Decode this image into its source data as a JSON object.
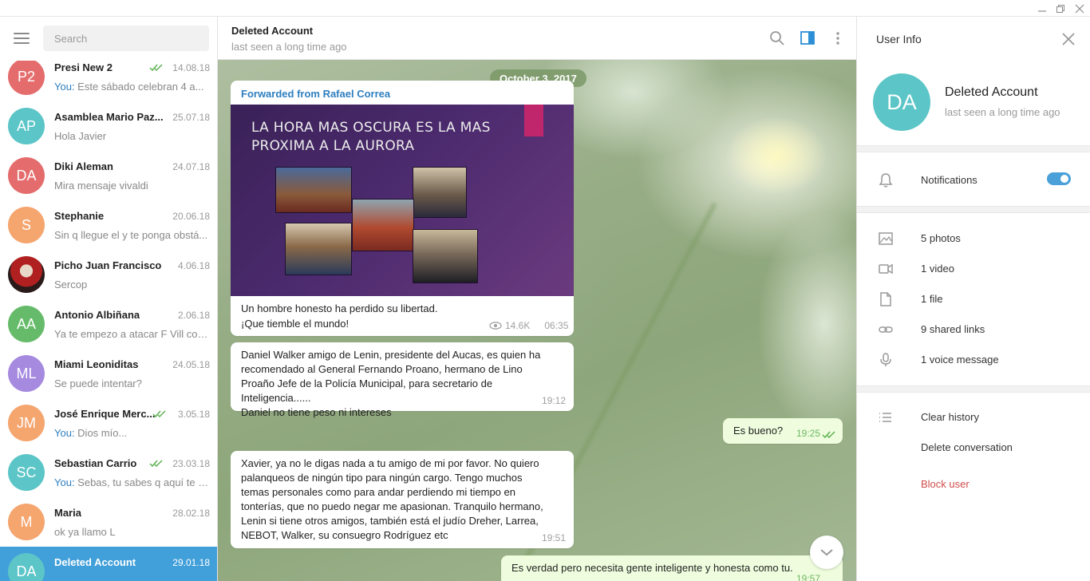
{
  "window": {
    "controls": [
      "minimize",
      "maximize",
      "close"
    ]
  },
  "sidebar": {
    "search_placeholder": "Search",
    "chats": [
      {
        "initials": "P2",
        "name": "Presi New 2",
        "date": "14.08.18",
        "you": "You:",
        "preview": "Este sábado celebran 4 a...",
        "color": "#e46c6c",
        "read": true
      },
      {
        "initials": "AP",
        "name": "Asamblea Mario Paz...",
        "date": "25.07.18",
        "you": "",
        "preview": "Hola Javier",
        "color": "#5bc5c7",
        "read": false
      },
      {
        "initials": "DA",
        "name": "Diki Aleman",
        "date": "24.07.18",
        "you": "",
        "preview": "Mira mensaje vivaldi",
        "color": "#e46c6c",
        "read": false
      },
      {
        "initials": "S",
        "name": "Stephanie",
        "date": "20.06.18",
        "you": "",
        "preview": "Sin q llegue el y te ponga obstá...",
        "color": "#f5a56e",
        "read": false
      },
      {
        "initials": "",
        "name": "Picho Juan Francisco",
        "date": "4.06.18",
        "you": "",
        "preview": "Sercop",
        "color": "#7a1a1a",
        "read": false
      },
      {
        "initials": "AA",
        "name": "Antonio Albiñana",
        "date": "2.06.18",
        "you": "",
        "preview": "Ya te empezo a atacar F Vill con...",
        "color": "#66bb6a",
        "read": false
      },
      {
        "initials": "ML",
        "name": "Miami Leoniditas",
        "date": "24.05.18",
        "you": "",
        "preview": "Se puede intentar?",
        "color": "#a58ae0",
        "read": false
      },
      {
        "initials": "JM",
        "name": "José Enrique Merc...",
        "date": "3.05.18",
        "you": "You:",
        "preview": "Dios mío...",
        "color": "#f5a56e",
        "read": true
      },
      {
        "initials": "SC",
        "name": "Sebastian Carrio",
        "date": "23.03.18",
        "you": "You:",
        "preview": "Sebas, tu sabes q aquí te q...",
        "color": "#5bc5c7",
        "read": true
      },
      {
        "initials": "M",
        "name": "Maria",
        "date": "28.02.18",
        "you": "",
        "preview": "ok ya llamo L",
        "color": "#f5a56e",
        "read": false
      },
      {
        "initials": "DA",
        "name": "Deleted Account",
        "date": "29.01.18",
        "you": "",
        "preview": "",
        "color": "#5bc5c7",
        "read": false
      }
    ]
  },
  "chat": {
    "title": "Deleted Account",
    "status": "last seen a long time ago",
    "date_pill": "October 3, 2017",
    "forwarded_label": "Forwarded from Rafael Correa",
    "slide_title_line1": "LA HORA MAS OSCURA ES LA MAS",
    "slide_title_line2": "PROXIMA A LA AURORA",
    "msg1_line1": "Un hombre honesto ha perdido su libertad.",
    "msg1_line2": "¡Que tiemble el mundo!",
    "msg1_views": "14.6K",
    "msg1_time": "06:35",
    "msg2_lines": [
      "Daniel Walker amigo de Lenin, presidente del Aucas, es quien ha",
      "recomendado al General  Fernando Proano,  hermano de Lino",
      "Proaño Jefe de la Policía Municipal, para secretario de Inteligencia......",
      "Daniel no tiene peso ni intereses"
    ],
    "msg2_time": "19:12",
    "msg3_text": "Es bueno?",
    "msg3_time": "19:25",
    "msg4_lines": [
      "Xavier, ya no le digas nada a tu amigo de mi por favor. No quiero",
      "palanqueos de ningún tipo para ningún cargo. Tengo muchos",
      "temas personales como para andar perdiendo mi tiempo en",
      "tonterías,  que no puedo negar me apasionan.  Tranquilo hermano,",
      "Lenin si tiene otros amigos, también está el judío Dreher, Larrea,",
      "NEBOT, Walker, su consuegro Rodríguez etc"
    ],
    "msg4_time": "19:51",
    "msg5_text": "Es verdad pero necesita gente inteligente y honesta como tu.",
    "msg5_time": "19:57"
  },
  "info": {
    "title": "User Info",
    "initials": "DA",
    "name": "Deleted Account",
    "status": "last seen a long time ago",
    "notifications_label": "Notifications",
    "notifications_on": true,
    "photos": "5 photos",
    "video": "1 video",
    "file": "1 file",
    "links": "9 shared links",
    "voice": "1 voice message",
    "clear_history": "Clear history",
    "delete_conversation": "Delete conversation",
    "block_user": "Block user"
  }
}
